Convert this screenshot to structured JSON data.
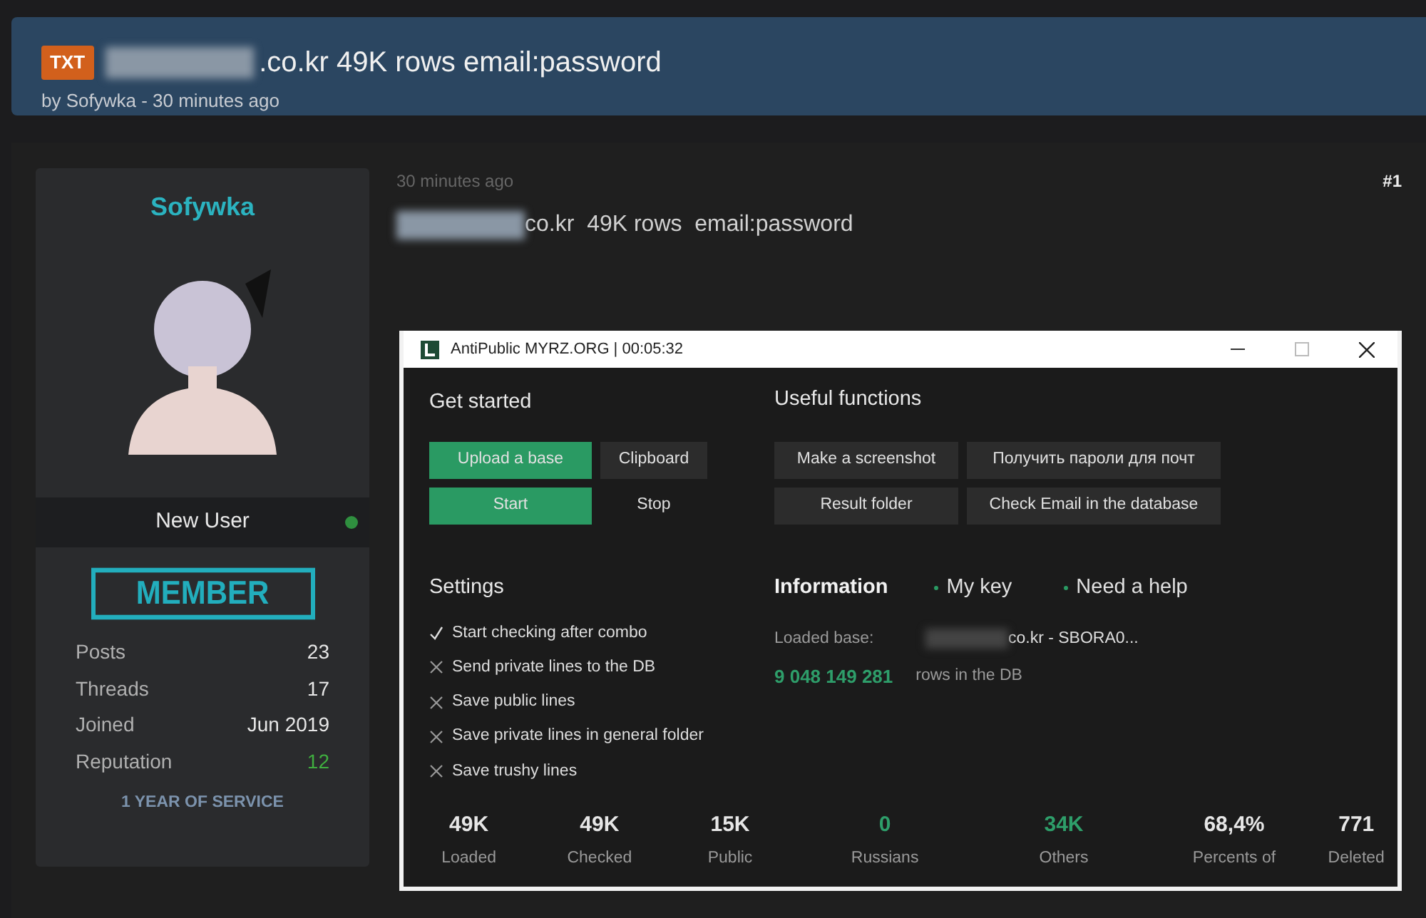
{
  "thread": {
    "prefix": "TXT",
    "title": ".co.kr 49K rows email:password",
    "byline": "by Sofywka - 30 minutes ago"
  },
  "user": {
    "name": "Sofywka",
    "rank": "New User",
    "online": true,
    "badge": "MEMBER",
    "stats": [
      {
        "label": "Posts",
        "value": "23",
        "color": "#e6e6e6"
      },
      {
        "label": "Threads",
        "value": "17",
        "color": "#e6e6e6"
      },
      {
        "label": "Joined",
        "value": "Jun 2019",
        "color": "#e6e6e6"
      },
      {
        "label": "Reputation",
        "value": "12",
        "color": "#3fae3f"
      }
    ],
    "award": "1 YEAR OF SERVICE"
  },
  "post": {
    "time": "30 minutes ago",
    "number": "#1",
    "text": "co.kr  49K rows  email:password"
  },
  "app": {
    "title": "AntiPublic MYRZ.ORG | 00:05:32",
    "get_started": {
      "heading": "Get started",
      "buttons": [
        {
          "label": "Upload a base",
          "kind": "primary"
        },
        {
          "label": "Clipboard",
          "kind": "secondary"
        },
        {
          "label": "Start",
          "kind": "primary"
        },
        {
          "label": "Stop",
          "kind": "plain"
        }
      ]
    },
    "useful": {
      "heading": "Useful functions",
      "buttons": [
        {
          "label": "Make a screenshot"
        },
        {
          "label": "Получить пароли для почт"
        },
        {
          "label": "Result folder"
        },
        {
          "label": "Check Email in the database"
        }
      ]
    },
    "settings": {
      "heading": "Settings",
      "items": [
        {
          "label": "Start checking after combo",
          "checked": true
        },
        {
          "label": "Send private lines to the DB",
          "checked": false
        },
        {
          "label": "Save public lines",
          "checked": false
        },
        {
          "label": "Save private lines in general folder",
          "checked": false
        },
        {
          "label": "Save trushy lines",
          "checked": false
        }
      ]
    },
    "info": {
      "tabs": [
        {
          "label": "Information",
          "selected": true
        },
        {
          "label": "My key",
          "selected": false
        },
        {
          "label": "Need a help",
          "selected": false
        }
      ],
      "loaded_label": "Loaded base:",
      "loaded_value": "co.kr - SBORA0...",
      "rows_count": "9 048 149 281",
      "rows_label": "rows in the DB"
    },
    "stats": [
      {
        "value": "49K",
        "label": "Loaded",
        "color": "#e6e6e6"
      },
      {
        "value": "49K",
        "label": "Checked",
        "color": "#e6e6e6"
      },
      {
        "value": "15K",
        "label": "Public",
        "color": "#e6e6e6"
      },
      {
        "value": "0",
        "label": "Russians",
        "color": "#2e9e6a"
      },
      {
        "value": "34K",
        "label": "Others",
        "color": "#2e9e6a"
      },
      {
        "value": "68,4%",
        "label": "Percents of",
        "color": "#e6e6e6"
      },
      {
        "value": "771",
        "label": "Deleted",
        "color": "#e6e6e6"
      }
    ]
  }
}
